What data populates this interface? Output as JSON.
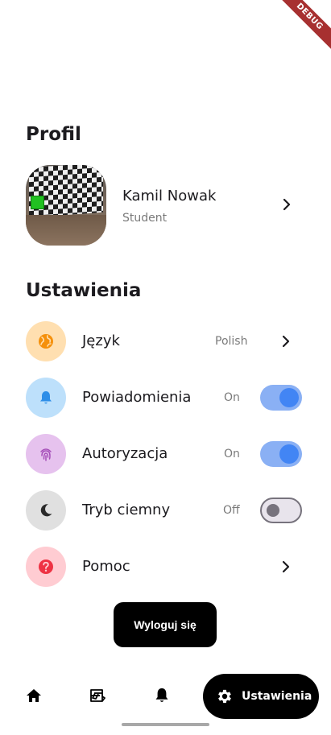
{
  "debug_banner": "DEBUG",
  "profile": {
    "title": "Profil",
    "name": "Kamil Nowak",
    "role": "Student"
  },
  "settings": {
    "title": "Ustawienia",
    "items": [
      {
        "label": "Język",
        "value": "Polish",
        "icon": "globe-icon",
        "control": "chevron",
        "icon_bg": "#ffdfb0",
        "icon_color": "#f5900b"
      },
      {
        "label": "Powiadomienia",
        "value": "On",
        "icon": "bell-icon",
        "control": "toggle-on",
        "icon_bg": "#bde0fb",
        "icon_color": "#2d8ee8"
      },
      {
        "label": "Autoryzacja",
        "value": "On",
        "icon": "fingerprint-icon",
        "control": "toggle-on",
        "icon_bg": "#e6c2ee",
        "icon_color": "#a64fb9"
      },
      {
        "label": "Tryb ciemny",
        "value": "Off",
        "icon": "moon-icon",
        "control": "toggle-off",
        "icon_bg": "#e0e0e0",
        "icon_color": "#2a2a2a"
      },
      {
        "label": "Pomoc",
        "value": "",
        "icon": "help-icon",
        "control": "chevron",
        "icon_bg": "#ffccd2",
        "icon_color": "#ee3344"
      }
    ]
  },
  "logout_label": "Wyloguj się",
  "bottom_nav": {
    "items": [
      {
        "icon": "home-icon"
      },
      {
        "icon": "shelf-icon"
      },
      {
        "icon": "bell-icon"
      }
    ],
    "active_label": "Ustawienia",
    "active_icon": "gear-icon"
  },
  "colors": {
    "toggle_on_track": "#8ab0f4",
    "toggle_on_knob": "#4285f4",
    "primary_button": "#000000"
  }
}
